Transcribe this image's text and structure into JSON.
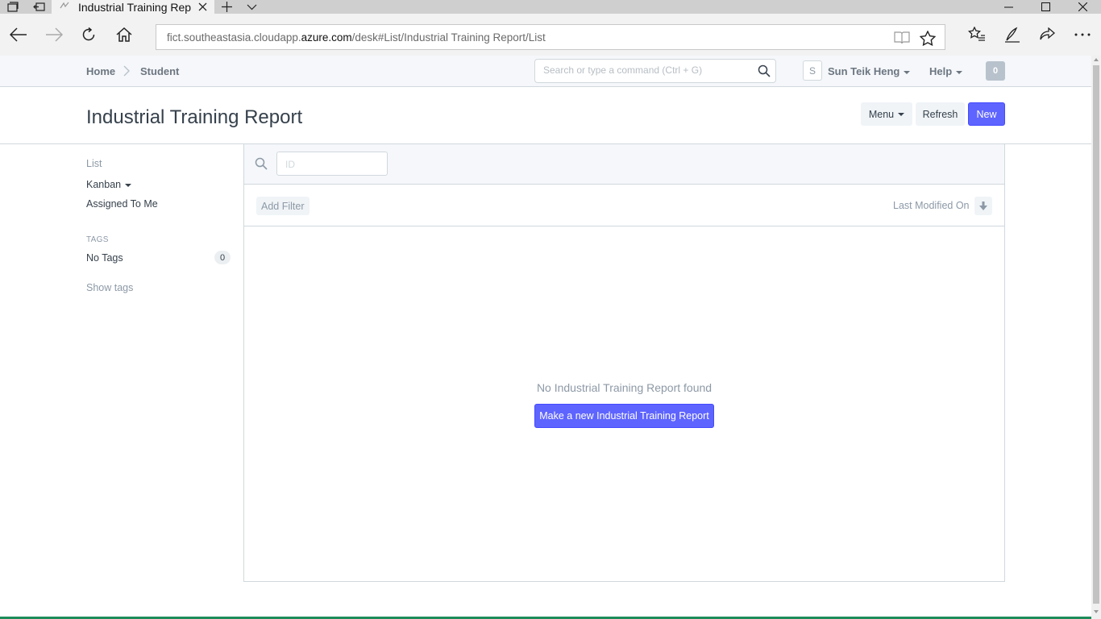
{
  "browser": {
    "tab_title": "Industrial Training Repo",
    "url_prefix": "fict.southeastasia.cloudapp.",
    "url_domain": "azure.com",
    "url_suffix": "/desk#List/Industrial Training Report/List"
  },
  "header": {
    "breadcrumbs": [
      "Home",
      "Student"
    ],
    "search_placeholder": "Search or type a command (Ctrl + G)",
    "avatar_initial": "S",
    "user_name": "Sun Teik Heng",
    "help_label": "Help",
    "notification_count": "0"
  },
  "page": {
    "title": "Industrial Training Report",
    "menu_label": "Menu",
    "refresh_label": "Refresh",
    "new_label": "New"
  },
  "sidebar": {
    "list_label": "List",
    "kanban_label": "Kanban",
    "assigned_label": "Assigned To Me",
    "tags_heading": "TAGS",
    "no_tags_label": "No Tags",
    "no_tags_count": "0",
    "show_tags_label": "Show tags"
  },
  "list": {
    "id_placeholder": "ID",
    "add_filter_label": "Add Filter",
    "sort_label": "Last Modified On",
    "empty_message": "No Industrial Training Report found",
    "make_new_label": "Make a new Industrial Training Report"
  },
  "colors": {
    "primary": "#5e64ff",
    "text": "#36414c",
    "muted": "#8d99a6",
    "border": "#d1d8dd"
  }
}
